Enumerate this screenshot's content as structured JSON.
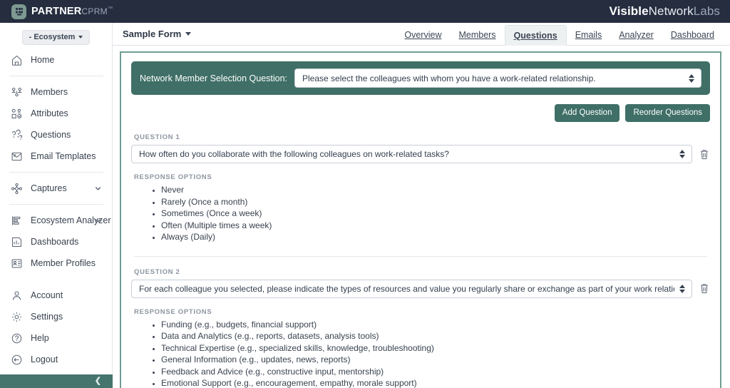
{
  "topbar": {
    "brand_main": "PARTNER",
    "brand_sub": "CPRM",
    "brand_tm": "™",
    "logo_icon": "network-nodes-icon",
    "right_logo_1": "Visible",
    "right_logo_2": "Network",
    "right_logo_3": "Labs"
  },
  "sidebar": {
    "ecosystem_button": "- Ecosystem",
    "items": [
      {
        "label": "Home",
        "icon": "home-icon"
      },
      {
        "label": "Members",
        "icon": "members-icon"
      },
      {
        "label": "Attributes",
        "icon": "attributes-icon"
      },
      {
        "label": "Questions",
        "icon": "questions-icon"
      },
      {
        "label": "Email Templates",
        "icon": "email-template-icon"
      },
      {
        "label": "Captures",
        "icon": "captures-icon",
        "chevron": "chevron-down-icon"
      },
      {
        "label": "Ecosystem Analyzer",
        "icon": "analyzer-icon",
        "chevron": "chevron-down-icon"
      },
      {
        "label": "Dashboards",
        "icon": "dashboards-icon"
      },
      {
        "label": "Member Profiles",
        "icon": "member-profiles-icon"
      }
    ],
    "bottom_items": [
      {
        "label": "Account",
        "icon": "user-icon"
      },
      {
        "label": "Settings",
        "icon": "gear-icon"
      },
      {
        "label": "Help",
        "icon": "help-icon"
      },
      {
        "label": "Logout",
        "icon": "logout-icon"
      }
    ],
    "collapse_icon": "chevron-left-icon"
  },
  "subnav": {
    "form_name": "Sample Form",
    "tabs": [
      {
        "label": "Overview",
        "active": false
      },
      {
        "label": "Members",
        "active": false
      },
      {
        "label": "Questions",
        "active": true
      },
      {
        "label": "Emails",
        "active": false
      },
      {
        "label": "Analyzer",
        "active": false
      },
      {
        "label": "Dashboard",
        "active": false
      }
    ]
  },
  "main": {
    "selection_question": {
      "label": "Network Member Selection Question:",
      "value": "Please select the colleagues with whom you have a work-related relationship.",
      "spinner_icon": "updown-spinner-icon"
    },
    "buttons": {
      "add_question": "Add Question",
      "reorder_questions": "Reorder Questions"
    },
    "questions": [
      {
        "number_label": "QUESTION 1",
        "text": "How often do you collaborate with the following colleagues on work-related tasks?",
        "delete_icon": "trash-icon",
        "spinner_icon": "updown-spinner-icon",
        "response_options_label": "RESPONSE OPTIONS",
        "options": [
          "Never",
          "Rarely (Once a month)",
          "Sometimes (Once a week)",
          "Often (Multiple times a week)",
          "Always (Daily)"
        ]
      },
      {
        "number_label": "QUESTION 2",
        "text": "For each colleague you selected, please indicate the types of resources and value you regularly share or exchange as part of your work relationship. (Select all that apply fo",
        "delete_icon": "trash-icon",
        "spinner_icon": "updown-spinner-icon",
        "response_options_label": "RESPONSE OPTIONS",
        "options": [
          "Funding (e.g., budgets, financial support)",
          "Data and Analytics (e.g., reports, datasets, analysis tools)",
          "Technical Expertise (e.g., specialized skills, knowledge, troubleshooting)",
          "General Information (e.g., updates, news, reports)",
          "Feedback and Advice (e.g., constructive input, mentorship)",
          "Emotional Support (e.g., encouragement, empathy, morale support)"
        ]
      }
    ]
  },
  "colors": {
    "topbar": "#252d3f",
    "accent_green": "#3f6f66",
    "card_border": "#6f9c93",
    "footer_green": "#45756d",
    "text": "#39424f",
    "muted": "#8d95a1"
  }
}
